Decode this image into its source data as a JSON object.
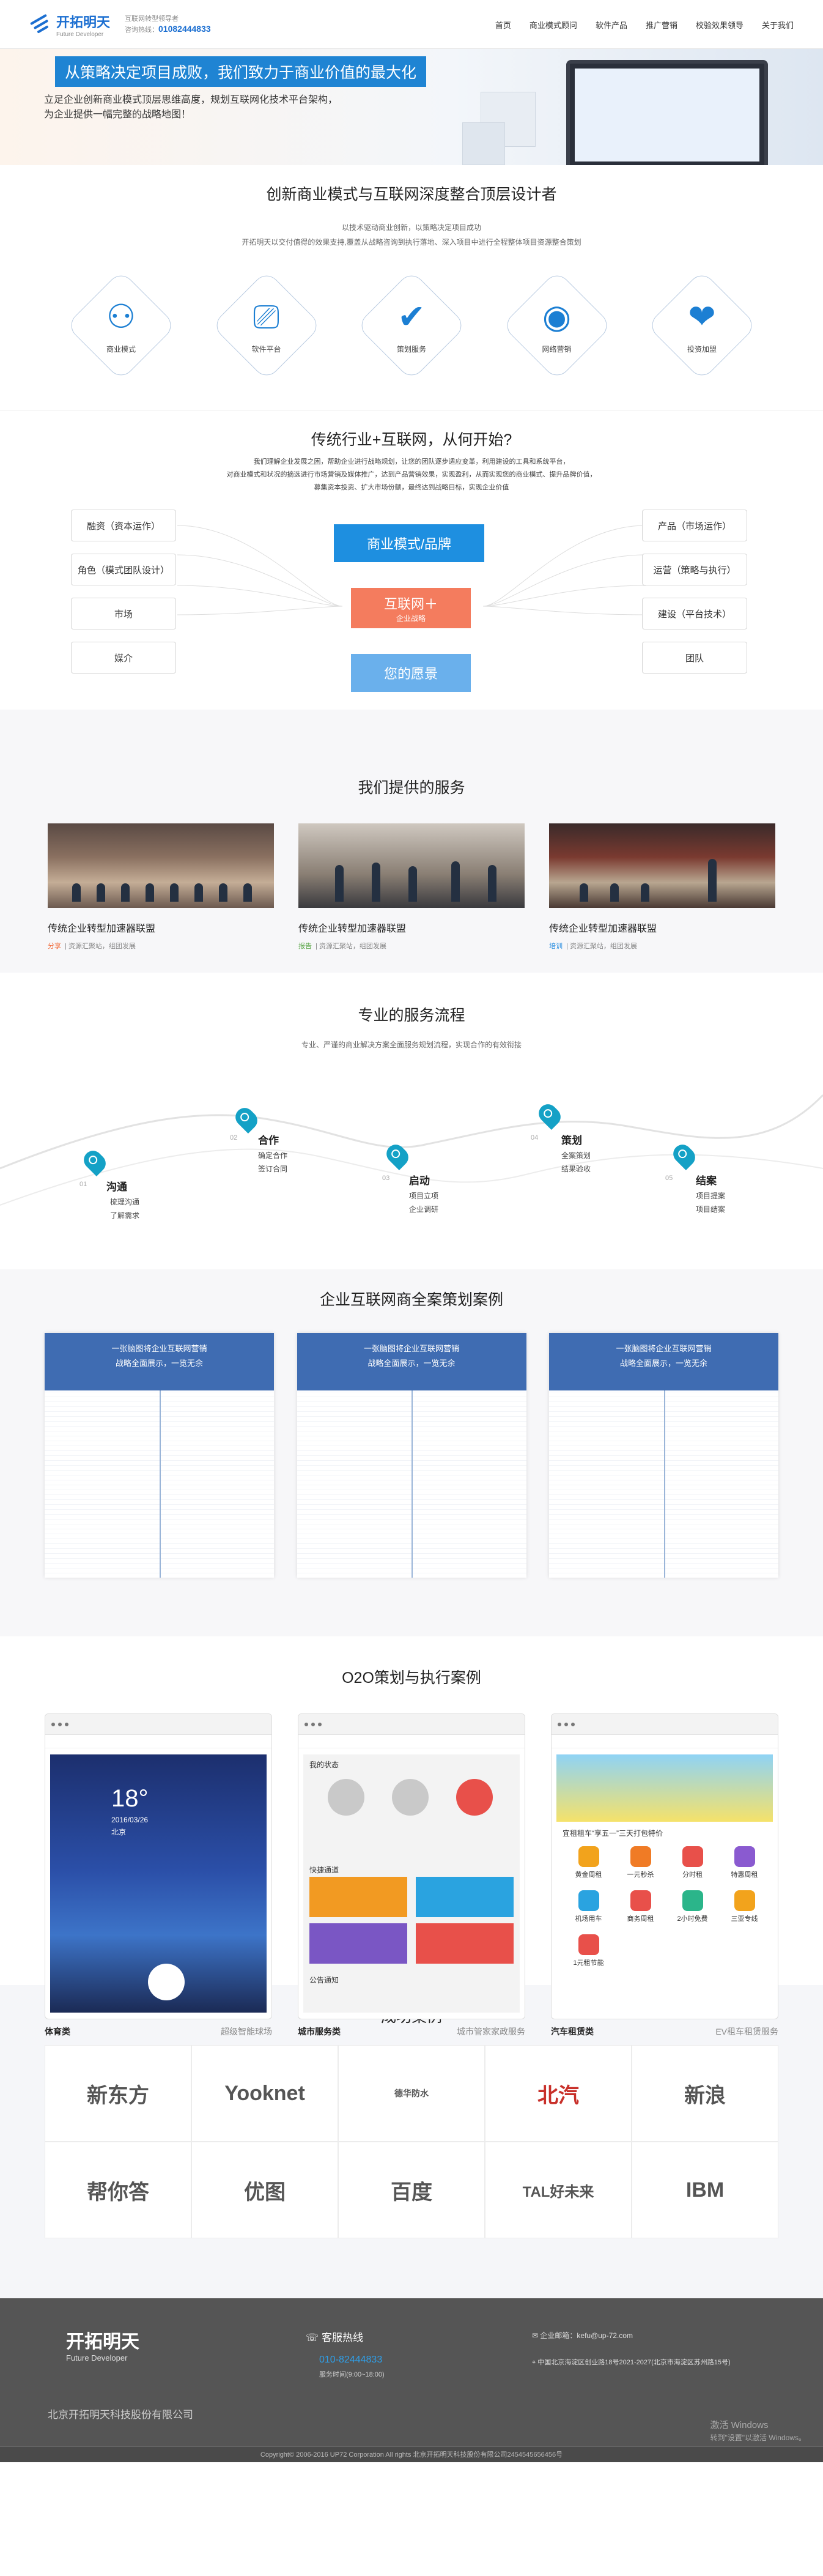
{
  "header": {
    "brand_cn": "开拓明天",
    "brand_en": "Future Developer",
    "info_line1": "互联网转型领导者",
    "info_line2_prefix": "咨询热线：",
    "phone": "01082444833",
    "nav": [
      "首页",
      "商业模式顾问",
      "软件产品",
      "推广营销",
      "校验效果领导",
      "关于我们"
    ]
  },
  "hero": {
    "headline": "从策略决定项目成败，我们致力于商业价值的最大化",
    "line1": "立足企业创新商业模式顶层思维高度，规划互联网化技术平台架构，",
    "line2": "为企业提供一幅完整的战略地图！"
  },
  "s1": {
    "title": "创新商业模式与互联网深度整合顶层设计者",
    "sub1": "以技术驱动商业创新，以策略决定项目成功",
    "sub2": "开拓明天以交付值得的效果支持,覆盖从战略咨询到执行落地、深入项目中进行全程整体项目资源整合策划",
    "items": [
      {
        "icon": "circles-icon",
        "label": "商业模式"
      },
      {
        "icon": "monitor-chart-icon",
        "label": "软件平台"
      },
      {
        "icon": "pin-check-icon",
        "label": "策划服务"
      },
      {
        "icon": "signal-icon",
        "label": "网络营销"
      },
      {
        "icon": "handshake-icon",
        "label": "投资加盟"
      }
    ]
  },
  "s2": {
    "title": "传统行业+互联网，从何开始?",
    "p1": "我们理解企业发展之困，帮助企业进行战略规划，让您的团队逐步适应变革，利用建设的工具和系统平台，",
    "p2": "对商业模式和状况的摘选进行市场营销及媒体推广，达到产品营销效果，实现盈利，从而实现您的商业模式、提升品牌价值，",
    "p3": "募集资本投资、扩大市场份额，最终达到战略目标，实现企业价值",
    "left": [
      "融资（资本运作）",
      "角色（模式团队设计）",
      "市场",
      "媒介"
    ],
    "right": [
      "产品（市场运作）",
      "运营（策略与执行）",
      "建设（平台技术）",
      "团队"
    ],
    "center_top": "商业模式/品牌",
    "center_mid": "互联网＋",
    "center_mid_sub": "企业战略",
    "center_bottom": "您的愿景"
  },
  "s3": {
    "title": "我们提供的服务",
    "cards": [
      {
        "title": "传统企业转型加速器联盟",
        "tag": "分享",
        "meta": "| 资源汇聚站，组团发展"
      },
      {
        "title": "传统企业转型加速器联盟",
        "tag": "报告",
        "meta": "| 资源汇聚站，组团发展"
      },
      {
        "title": "传统企业转型加速器联盟",
        "tag": "培训",
        "meta": "| 资源汇聚站，组团发展"
      }
    ]
  },
  "s4": {
    "title": "专业的服务流程",
    "sub": "专业、严谨的商业解决方案全面服务规划流程，实现合作的有效衔接",
    "steps": [
      {
        "num": "01",
        "title": "沟通",
        "d1": "梳理沟通",
        "d2": "了解需求"
      },
      {
        "num": "02",
        "title": "合作",
        "d1": "确定合作",
        "d2": "签订合同"
      },
      {
        "num": "03",
        "title": "启动",
        "d1": "项目立项",
        "d2": "企业调研"
      },
      {
        "num": "04",
        "title": "策划",
        "d1": "全案策划",
        "d2": "结果验收"
      },
      {
        "num": "05",
        "title": "结案",
        "d1": "项目提案",
        "d2": "项目结案"
      }
    ]
  },
  "s5": {
    "title": "企业互联网商全案策划案例",
    "card_head1": "一张脑图将企业互联网营销",
    "card_head2": "战略全面展示，一览无余"
  },
  "s6": {
    "title": "O2O策划与执行案例",
    "cards": [
      {
        "name": "体育类",
        "desc": "超级智能球场"
      },
      {
        "name": "城市服务类",
        "desc": "城市管家家政服务"
      },
      {
        "name": "汽车租赁类",
        "desc": "EV租车租赁服务"
      }
    ],
    "phone1_temp": "18°",
    "phone1_date": "2016/03/26",
    "phone1_city": "北京",
    "phone2_state": "我的状态",
    "phone2_quick": "快捷通道",
    "phone2_notice": "公告通知",
    "phone3_banner": "宜租租车“享五一”三天打包特价",
    "phone3_items": [
      "黄金周租",
      "一元秒杀",
      "分时租",
      "特惠周租",
      "机场用车",
      "商务周租",
      "2小时免费",
      "三亚专线",
      "1元租节能"
    ]
  },
  "s7": {
    "title": "成功案例",
    "logos": [
      "新东方",
      "Yooknet",
      "德华防水",
      "北汽",
      "新浪",
      "帮你答",
      "优图",
      "百度",
      "TAL好未来",
      "IBM"
    ]
  },
  "footer": {
    "brand": "开拓明天",
    "brand_en": "Future Developer",
    "company": "北京开拓明天科技股份有限公司",
    "hotline": "客服热线",
    "tel": "010-82444833",
    "hours": "服务时间(9:00~18:00)",
    "mail": "企业邮箱：kefu@up-72.com",
    "address": "中国北京海淀区创业路18号2021-2027(北京市海淀区苏州路15号)",
    "copyright": "Copyright© 2006-2016 UP72 Corporation All rights 北京开拓明天科技股份有限公司2454545656456号",
    "watermark1": "激活 Windows",
    "watermark2": "转到\"设置\"以激活 Windows。"
  }
}
